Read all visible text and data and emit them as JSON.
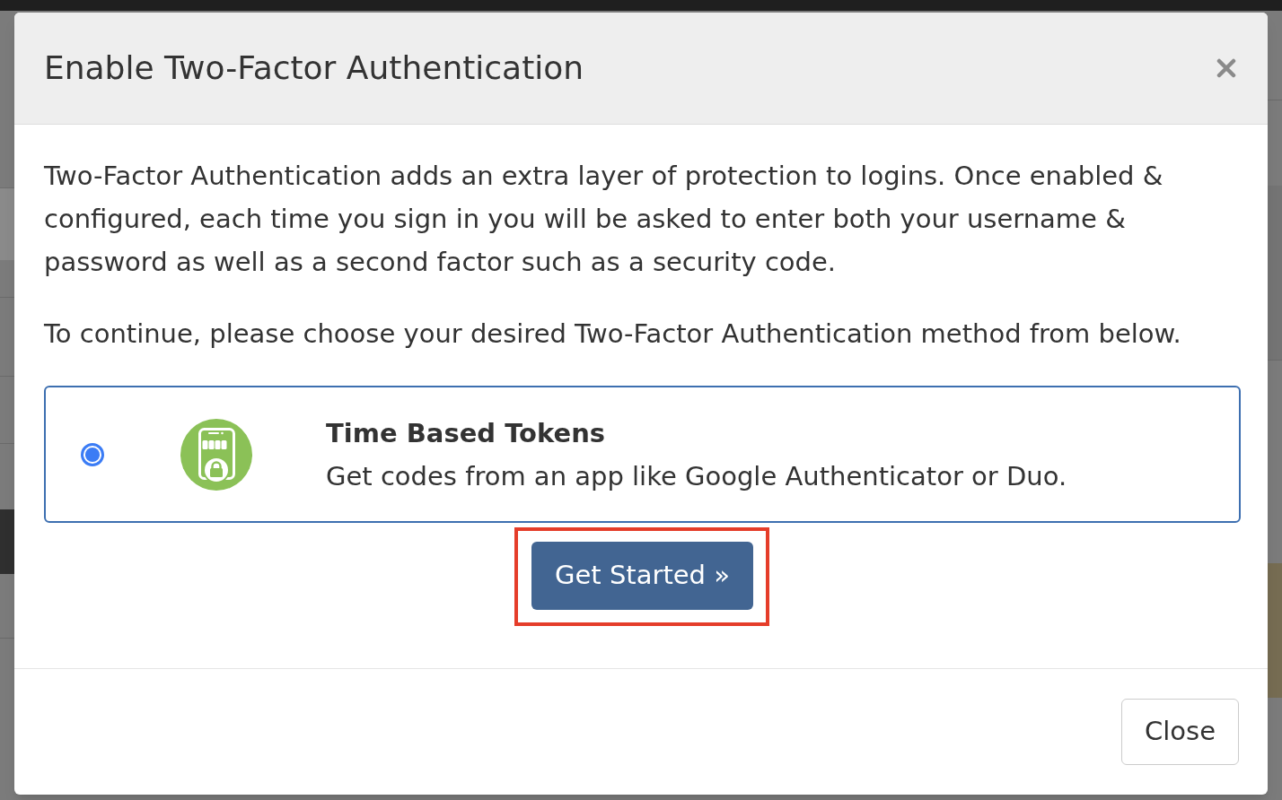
{
  "modal": {
    "title": "Enable Two-Factor Authentication",
    "paragraphs": [
      "Two-Factor Authentication adds an extra layer of protection to logins. Once enabled & configured, each time you sign in you will be asked to enter both your username & password as well as a second factor such as a security code.",
      "To continue, please choose your desired Two-Factor Authentication method from below."
    ],
    "methods": [
      {
        "title": "Time Based Tokens",
        "description": "Get codes from an app like Google Authenticator or Duo.",
        "selected": true
      }
    ],
    "primary_button": {
      "label": "Get Started »",
      "highlighted": true
    },
    "footer_buttons": [
      {
        "label": "Close"
      }
    ]
  }
}
